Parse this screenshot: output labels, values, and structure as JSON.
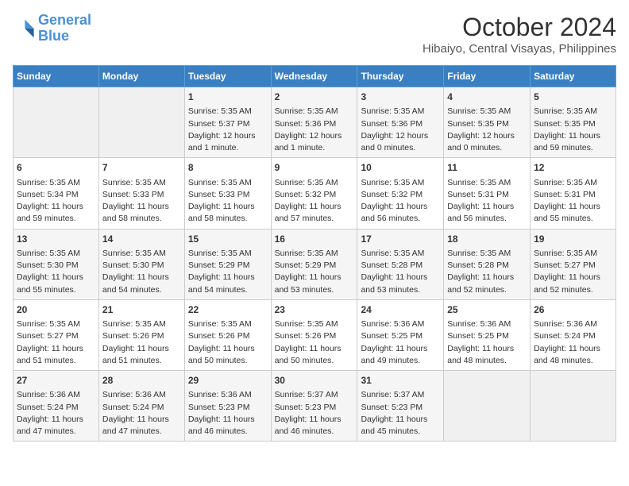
{
  "header": {
    "logo_line1": "General",
    "logo_line2": "Blue",
    "month": "October 2024",
    "location": "Hibaiyo, Central Visayas, Philippines"
  },
  "weekdays": [
    "Sunday",
    "Monday",
    "Tuesday",
    "Wednesday",
    "Thursday",
    "Friday",
    "Saturday"
  ],
  "weeks": [
    [
      {
        "day": "",
        "content": ""
      },
      {
        "day": "",
        "content": ""
      },
      {
        "day": "1",
        "content": "Sunrise: 5:35 AM\nSunset: 5:37 PM\nDaylight: 12 hours\nand 1 minute."
      },
      {
        "day": "2",
        "content": "Sunrise: 5:35 AM\nSunset: 5:36 PM\nDaylight: 12 hours\nand 1 minute."
      },
      {
        "day": "3",
        "content": "Sunrise: 5:35 AM\nSunset: 5:36 PM\nDaylight: 12 hours\nand 0 minutes."
      },
      {
        "day": "4",
        "content": "Sunrise: 5:35 AM\nSunset: 5:35 PM\nDaylight: 12 hours\nand 0 minutes."
      },
      {
        "day": "5",
        "content": "Sunrise: 5:35 AM\nSunset: 5:35 PM\nDaylight: 11 hours\nand 59 minutes."
      }
    ],
    [
      {
        "day": "6",
        "content": "Sunrise: 5:35 AM\nSunset: 5:34 PM\nDaylight: 11 hours\nand 59 minutes."
      },
      {
        "day": "7",
        "content": "Sunrise: 5:35 AM\nSunset: 5:33 PM\nDaylight: 11 hours\nand 58 minutes."
      },
      {
        "day": "8",
        "content": "Sunrise: 5:35 AM\nSunset: 5:33 PM\nDaylight: 11 hours\nand 58 minutes."
      },
      {
        "day": "9",
        "content": "Sunrise: 5:35 AM\nSunset: 5:32 PM\nDaylight: 11 hours\nand 57 minutes."
      },
      {
        "day": "10",
        "content": "Sunrise: 5:35 AM\nSunset: 5:32 PM\nDaylight: 11 hours\nand 56 minutes."
      },
      {
        "day": "11",
        "content": "Sunrise: 5:35 AM\nSunset: 5:31 PM\nDaylight: 11 hours\nand 56 minutes."
      },
      {
        "day": "12",
        "content": "Sunrise: 5:35 AM\nSunset: 5:31 PM\nDaylight: 11 hours\nand 55 minutes."
      }
    ],
    [
      {
        "day": "13",
        "content": "Sunrise: 5:35 AM\nSunset: 5:30 PM\nDaylight: 11 hours\nand 55 minutes."
      },
      {
        "day": "14",
        "content": "Sunrise: 5:35 AM\nSunset: 5:30 PM\nDaylight: 11 hours\nand 54 minutes."
      },
      {
        "day": "15",
        "content": "Sunrise: 5:35 AM\nSunset: 5:29 PM\nDaylight: 11 hours\nand 54 minutes."
      },
      {
        "day": "16",
        "content": "Sunrise: 5:35 AM\nSunset: 5:29 PM\nDaylight: 11 hours\nand 53 minutes."
      },
      {
        "day": "17",
        "content": "Sunrise: 5:35 AM\nSunset: 5:28 PM\nDaylight: 11 hours\nand 53 minutes."
      },
      {
        "day": "18",
        "content": "Sunrise: 5:35 AM\nSunset: 5:28 PM\nDaylight: 11 hours\nand 52 minutes."
      },
      {
        "day": "19",
        "content": "Sunrise: 5:35 AM\nSunset: 5:27 PM\nDaylight: 11 hours\nand 52 minutes."
      }
    ],
    [
      {
        "day": "20",
        "content": "Sunrise: 5:35 AM\nSunset: 5:27 PM\nDaylight: 11 hours\nand 51 minutes."
      },
      {
        "day": "21",
        "content": "Sunrise: 5:35 AM\nSunset: 5:26 PM\nDaylight: 11 hours\nand 51 minutes."
      },
      {
        "day": "22",
        "content": "Sunrise: 5:35 AM\nSunset: 5:26 PM\nDaylight: 11 hours\nand 50 minutes."
      },
      {
        "day": "23",
        "content": "Sunrise: 5:35 AM\nSunset: 5:26 PM\nDaylight: 11 hours\nand 50 minutes."
      },
      {
        "day": "24",
        "content": "Sunrise: 5:36 AM\nSunset: 5:25 PM\nDaylight: 11 hours\nand 49 minutes."
      },
      {
        "day": "25",
        "content": "Sunrise: 5:36 AM\nSunset: 5:25 PM\nDaylight: 11 hours\nand 48 minutes."
      },
      {
        "day": "26",
        "content": "Sunrise: 5:36 AM\nSunset: 5:24 PM\nDaylight: 11 hours\nand 48 minutes."
      }
    ],
    [
      {
        "day": "27",
        "content": "Sunrise: 5:36 AM\nSunset: 5:24 PM\nDaylight: 11 hours\nand 47 minutes."
      },
      {
        "day": "28",
        "content": "Sunrise: 5:36 AM\nSunset: 5:24 PM\nDaylight: 11 hours\nand 47 minutes."
      },
      {
        "day": "29",
        "content": "Sunrise: 5:36 AM\nSunset: 5:23 PM\nDaylight: 11 hours\nand 46 minutes."
      },
      {
        "day": "30",
        "content": "Sunrise: 5:37 AM\nSunset: 5:23 PM\nDaylight: 11 hours\nand 46 minutes."
      },
      {
        "day": "31",
        "content": "Sunrise: 5:37 AM\nSunset: 5:23 PM\nDaylight: 11 hours\nand 45 minutes."
      },
      {
        "day": "",
        "content": ""
      },
      {
        "day": "",
        "content": ""
      }
    ]
  ]
}
